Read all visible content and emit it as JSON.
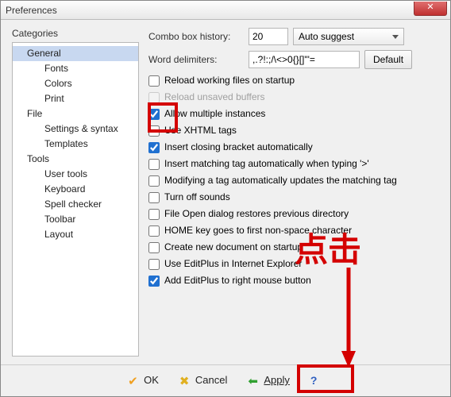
{
  "window": {
    "title": "Preferences"
  },
  "categories_label": "Categories",
  "tree": {
    "general": "General",
    "fonts": "Fonts",
    "colors": "Colors",
    "print": "Print",
    "file": "File",
    "settings_syntax": "Settings & syntax",
    "templates": "Templates",
    "tools": "Tools",
    "user_tools": "User tools",
    "keyboard": "Keyboard",
    "spell_checker": "Spell checker",
    "toolbar": "Toolbar",
    "layout": "Layout"
  },
  "form": {
    "combo_history_label": "Combo box history:",
    "combo_history_value": "20",
    "combo_suggest": "Auto suggest",
    "word_delim_label": "Word delimiters:",
    "word_delim_value": ",.?!:;/\\<>0{}[]\"'=",
    "default_btn": "Default"
  },
  "options": {
    "reload_working": "Reload working files on startup",
    "reload_unsaved": "Reload unsaved buffers",
    "allow_multiple": "Allow multiple instances",
    "use_xhtml": "Use XHTML tags",
    "insert_closing": "Insert closing bracket automatically",
    "insert_matching": "Insert matching tag automatically when typing '>'",
    "modify_tag": "Modifying a tag automatically updates the matching tag",
    "turn_off_sounds": "Turn off sounds",
    "file_open_restore": "File Open dialog restores previous directory",
    "home_key": "HOME key goes to first non-space character",
    "create_new_doc": "Create new document on startup",
    "use_ie": "Use EditPlus in Internet Explorer",
    "add_rightclick": "Add EditPlus to right mouse button"
  },
  "checked": {
    "allow_multiple": true,
    "insert_closing": true,
    "add_rightclick": true
  },
  "buttons": {
    "ok": "OK",
    "cancel": "Cancel",
    "apply": "Apply",
    "help": "?"
  },
  "annotation": {
    "text": "点击"
  }
}
